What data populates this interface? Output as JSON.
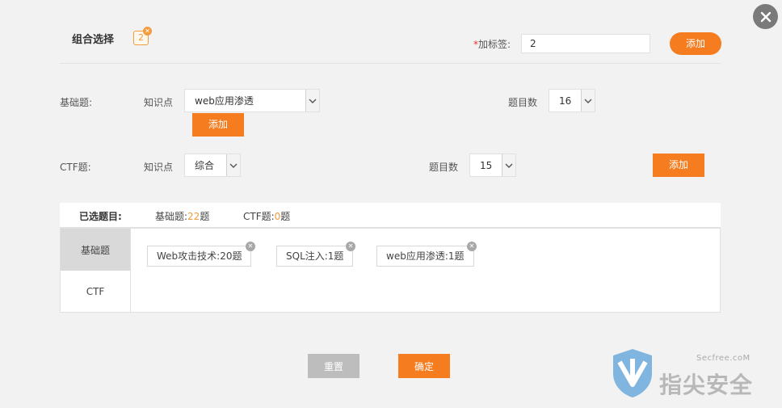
{
  "dialog": {
    "title": "组合选择",
    "combo_count": "2",
    "close_icon": "close-icon"
  },
  "tag_row": {
    "required_mark": "*",
    "label": "加标签:",
    "value": "2",
    "add_label": "添加"
  },
  "basic_row": {
    "label": "基础题:",
    "knowledge_label": "知识点",
    "knowledge_value": "web应用渗透",
    "count_label": "题目数",
    "count_value": "16",
    "add_label": "添加"
  },
  "ctf_row": {
    "label": "CTF题:",
    "knowledge_label": "知识点",
    "knowledge_value": "综合",
    "count_label": "题目数",
    "count_value": "15",
    "add_label": "添加"
  },
  "selected": {
    "title": "已选题目:",
    "basic_prefix": "基础题:",
    "basic_count": "22",
    "basic_suffix": "题",
    "ctf_prefix": "CTF题:",
    "ctf_count": "0",
    "ctf_suffix": "题"
  },
  "panel": {
    "tabs": [
      {
        "label": "基础题"
      },
      {
        "label": "CTF"
      }
    ],
    "tags": [
      {
        "label": "Web攻击技术:20题"
      },
      {
        "label": "SQL注入:1题"
      },
      {
        "label": "web应用渗透:1题"
      }
    ]
  },
  "footer": {
    "reset_label": "重置",
    "confirm_label": "确定"
  },
  "watermark": {
    "site": "Secfree.coM",
    "brand": "指尖安全"
  },
  "colors": {
    "accent": "#f57c1f",
    "highlight": "#f39c3d"
  }
}
